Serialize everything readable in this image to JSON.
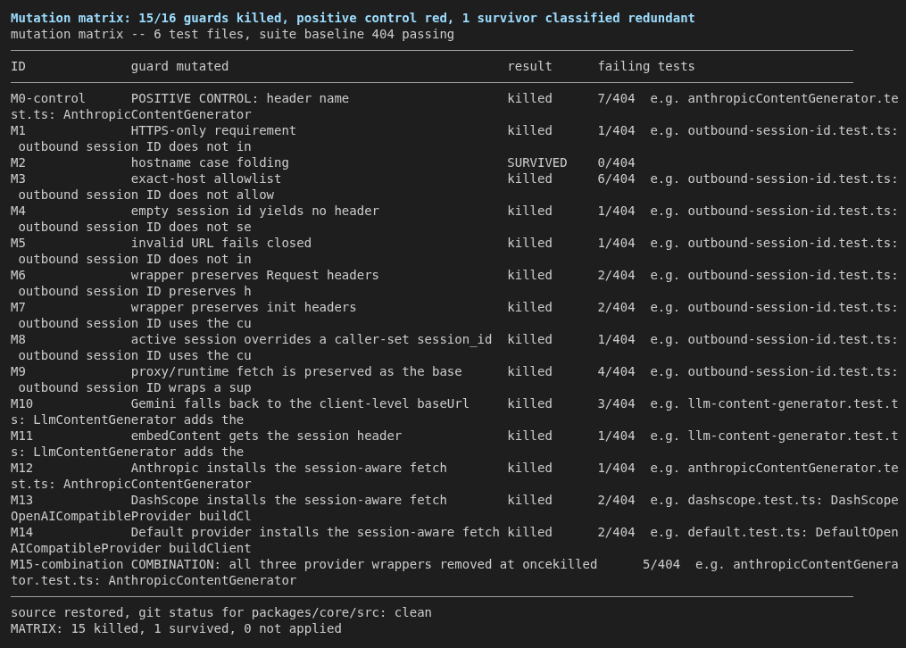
{
  "title": "Mutation matrix: 15/16 guards killed, positive control red, 1 survivor classified redundant",
  "subtitle": "mutation matrix -- 6 test files, suite baseline 404 passing",
  "table": {
    "header": "ID              guard mutated                                     result      failing tests",
    "lines": [
      "M0-control      POSITIVE CONTROL: header name                     killed      7/404  e.g. anthropicContentGenerator.test.ts: AnthropicContentGenerator",
      "M1              HTTPS-only requirement                            killed      1/404  e.g. outbound-session-id.test.ts: outbound session ID does not in",
      "M2              hostname case folding                             SURVIVED    0/404",
      "M3              exact-host allowlist                              killed      6/404  e.g. outbound-session-id.test.ts: outbound session ID does not allow",
      "M4              empty session id yields no header                 killed      1/404  e.g. outbound-session-id.test.ts: outbound session ID does not se",
      "M5              invalid URL fails closed                          killed      1/404  e.g. outbound-session-id.test.ts: outbound session ID does not in",
      "M6              wrapper preserves Request headers                 killed      2/404  e.g. outbound-session-id.test.ts: outbound session ID preserves h",
      "M7              wrapper preserves init headers                    killed      2/404  e.g. outbound-session-id.test.ts: outbound session ID uses the cu",
      "M8              active session overrides a caller-set session_id  killed      1/404  e.g. outbound-session-id.test.ts: outbound session ID uses the cu",
      "M9              proxy/runtime fetch is preserved as the base      killed      4/404  e.g. outbound-session-id.test.ts: outbound session ID wraps a sup",
      "M10             Gemini falls back to the client-level baseUrl     killed      3/404  e.g. llm-content-generator.test.ts: LlmContentGenerator adds the",
      "M11             embedContent gets the session header              killed      1/404  e.g. llm-content-generator.test.ts: LlmContentGenerator adds the",
      "M12             Anthropic installs the session-aware fetch        killed      1/404  e.g. anthropicContentGenerator.test.ts: AnthropicContentGenerator",
      "M13             DashScope installs the session-aware fetch        killed      2/404  e.g. dashscope.test.ts: DashScopeOpenAICompatibleProvider buildCl",
      "M14             Default provider installs the session-aware fetch killed      2/404  e.g. default.test.ts: DefaultOpenAICompatibleProvider buildClient",
      "M15-combination COMBINATION: all three provider wrappers removed at oncekilled      5/404  e.g. anthropicContentGenerator.test.ts: AnthropicContentGenerator"
    ]
  },
  "footer": [
    "source restored, git status for packages/core/src: clean",
    "MATRIX: 15 killed, 1 survived, 0 not applied"
  ]
}
